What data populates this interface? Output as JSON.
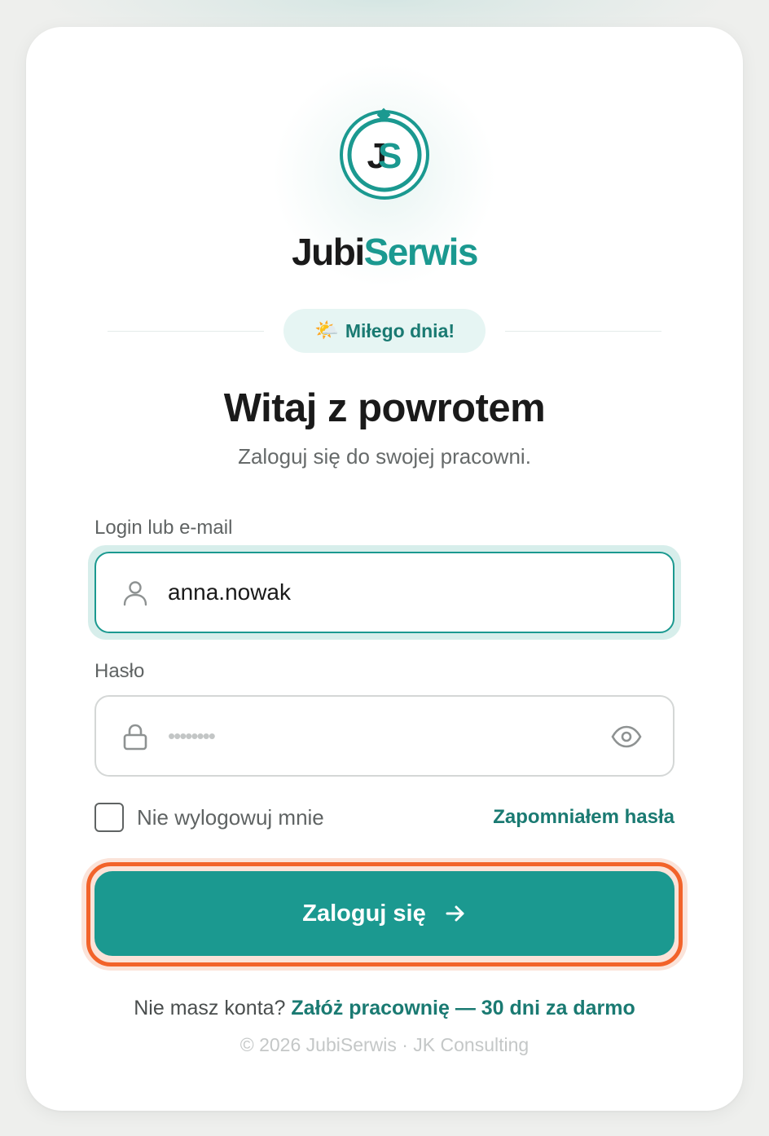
{
  "brand": {
    "name_dark": "Jubi",
    "name_accent": "Serwis",
    "monogram": "JS"
  },
  "greeting": {
    "emoji": "🌤️",
    "text": "Miłego dnia!"
  },
  "heading": {
    "title": "Witaj z powrotem",
    "subtitle": "Zaloguj się do swojej pracowni."
  },
  "login_field": {
    "label": "Login lub e-mail",
    "value": "anna.nowak",
    "icon": "user-icon"
  },
  "password_field": {
    "label": "Hasło",
    "masked_value": "••••••••",
    "icon": "lock-icon",
    "toggle_icon": "eye-icon"
  },
  "remember_me": {
    "label": "Nie wylogowuj mnie",
    "checked": false
  },
  "forgot_password": {
    "label": "Zapomniałem hasła"
  },
  "submit_button": {
    "label": "Zaloguj się",
    "icon": "arrow-right-icon"
  },
  "signup": {
    "prompt": "Nie masz konta?",
    "link_label": "Załóż pracownię — 30 dni za darmo"
  },
  "footer": {
    "text": "© 2026 JubiSerwis · JK Consulting"
  },
  "colors": {
    "accent": "#1b9990",
    "accent_dark": "#1a7a72",
    "highlight_outline": "#f2632a",
    "text_primary": "#1a1a1a",
    "text_secondary": "#666a6a"
  }
}
